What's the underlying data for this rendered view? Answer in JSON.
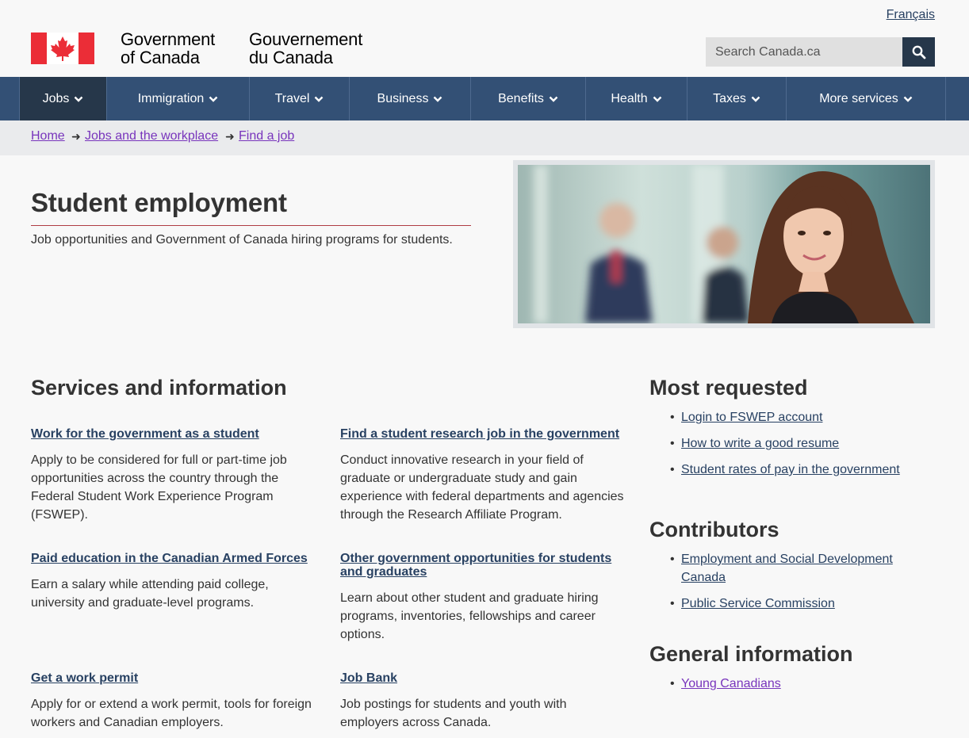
{
  "header": {
    "language_link": "Français",
    "gov_en_line1": "Government",
    "gov_en_line2": "of Canada",
    "gov_fr_line1": "Gouvernement",
    "gov_fr_line2": "du Canada",
    "search_placeholder": "Search Canada.ca",
    "flag_red": "#eb2d37",
    "search_icon": "magnifier-icon"
  },
  "nav": {
    "items": [
      {
        "label": "Jobs"
      },
      {
        "label": "Immigration"
      },
      {
        "label": "Travel"
      },
      {
        "label": "Business"
      },
      {
        "label": "Benefits"
      },
      {
        "label": "Health"
      },
      {
        "label": "Taxes"
      },
      {
        "label": "More services"
      }
    ],
    "background": "#335075",
    "active_background": "#26374a"
  },
  "breadcrumb": [
    "Home",
    "Jobs and the workplace",
    "Find a job"
  ],
  "page": {
    "title": "Student employment",
    "lead": "Job opportunities and Government of Canada hiring programs for students."
  },
  "services": {
    "heading": "Services and information",
    "items": [
      {
        "title": "Work for the government as a student",
        "desc": "Apply to be considered for full or part-time job opportunities across the country through the Federal Student Work Experience Program (FSWEP)."
      },
      {
        "title": "Find a student research job in the government",
        "desc": "Conduct innovative research in your field of graduate or undergraduate study and gain experience with federal departments and agencies through the Research Affiliate Program."
      },
      {
        "title": "Paid education in the Canadian Armed Forces",
        "desc": "Earn a salary while attending paid college, university and graduate-level programs."
      },
      {
        "title": "Other government opportunities for students and graduates",
        "desc": "Learn about other student and graduate hiring programs, inventories, fellowships and career options."
      },
      {
        "title": "Get a work permit",
        "desc": "Apply for or extend a work permit, tools for foreign workers and Canadian employers."
      },
      {
        "title": "Job Bank",
        "desc": "Job postings for students and youth with employers across Canada."
      }
    ]
  },
  "sidebar": {
    "most_requested": {
      "heading": "Most requested",
      "links": [
        "Login to FSWEP account",
        "How to write a good resume",
        "Student rates of pay in the government"
      ]
    },
    "contributors": {
      "heading": "Contributors",
      "links": [
        "Employment and Social Development Canada",
        "Public Service Commission"
      ]
    },
    "general_information": {
      "heading": "General information",
      "links": [
        "Young Canadians"
      ]
    }
  }
}
